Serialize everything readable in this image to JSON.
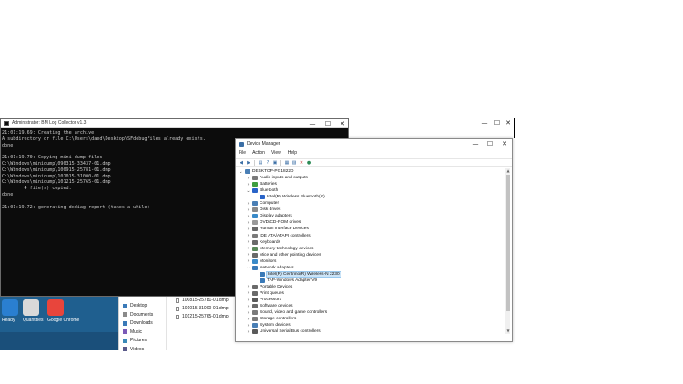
{
  "console": {
    "title": "Administrator: BM Log Collector v1.3",
    "lines": [
      "21:01:19.69: Creating the archive",
      "A subdirectory or file C:\\Users\\daed\\Desktop\\SFdebugFiles already exists.",
      "done",
      "",
      "21:01:19.70: Copying mini dump files",
      "C:\\Windows\\minidump\\090315-33437-01.dmp",
      "C:\\Windows\\minidump\\100915-25781-01.dmp",
      "C:\\Windows\\minidump\\101015-31000-01.dmp",
      "C:\\Windows\\minidump\\101215-25765-01.dmp",
      "        4 file(s) copied.",
      "done",
      "",
      "21:01:19.72: generating dxdiag report (takes a while)"
    ],
    "controls": {
      "minimize": "—",
      "maximize": "☐",
      "close": "✕"
    }
  },
  "bg_window": {
    "controls": {
      "minimize": "—",
      "maximize": "☐",
      "close": "✕"
    }
  },
  "desktop": {
    "icons": [
      {
        "label": "Ready",
        "color": "#2a7fd0"
      },
      {
        "label": "Quantities",
        "color": "#d9d9d9"
      },
      {
        "label": "Google Chrome",
        "color": "#e8453c"
      },
      {
        "label": "",
        "color": "#3b8ad8"
      },
      {
        "label": "",
        "color": "#22a83c"
      },
      {
        "label": "",
        "color": "#f4c542"
      }
    ]
  },
  "explorer": {
    "nav": [
      "Desktop",
      "Documents",
      "Downloads",
      "Music",
      "Pictures",
      "Videos"
    ],
    "files": [
      "100815-25781-01.dmp",
      "101015-31000-01.dmp",
      "101215-25765-01.dmp"
    ]
  },
  "device_manager": {
    "title": "Device Manager",
    "menu": [
      "File",
      "Action",
      "View",
      "Help"
    ],
    "controls": {
      "minimize": "—",
      "maximize": "☐",
      "close": "✕"
    },
    "tree": [
      {
        "label": "DESKTOP-PG1822D",
        "level": 0,
        "expander": "⌄",
        "icon": "computer",
        "color": "#4a7fb5"
      },
      {
        "label": "Audio inputs and outputs",
        "level": 1,
        "expander": "›",
        "icon": "audio",
        "color": "#7a7a7a"
      },
      {
        "label": "Batteries",
        "level": 1,
        "expander": "›",
        "icon": "battery",
        "color": "#3f9e3f"
      },
      {
        "label": "Bluetooth",
        "level": 1,
        "expander": "⌄",
        "icon": "bluetooth",
        "color": "#2a64c8"
      },
      {
        "label": "Intel(R) Wireless Bluetooth(R)",
        "level": 2,
        "expander": "",
        "icon": "bluetooth",
        "color": "#2a64c8"
      },
      {
        "label": "Computer",
        "level": 1,
        "expander": "›",
        "icon": "computer",
        "color": "#4a7fb5"
      },
      {
        "label": "Disk drives",
        "level": 1,
        "expander": "›",
        "icon": "disk",
        "color": "#8a8a8a"
      },
      {
        "label": "Display adapters",
        "level": 1,
        "expander": "›",
        "icon": "display",
        "color": "#3a8ac8"
      },
      {
        "label": "DVD/CD-ROM drives",
        "level": 1,
        "expander": "›",
        "icon": "dvd",
        "color": "#9a9a9a"
      },
      {
        "label": "Human Interface Devices",
        "level": 1,
        "expander": "›",
        "icon": "hid",
        "color": "#6a6a6a"
      },
      {
        "label": "IDE ATA/ATAPI controllers",
        "level": 1,
        "expander": "›",
        "icon": "ide",
        "color": "#7a7a7a"
      },
      {
        "label": "Keyboards",
        "level": 1,
        "expander": "›",
        "icon": "keyboard",
        "color": "#6a6a6a"
      },
      {
        "label": "Memory technology devices",
        "level": 1,
        "expander": "›",
        "icon": "memory",
        "color": "#5a8a5a"
      },
      {
        "label": "Mice and other pointing devices",
        "level": 1,
        "expander": "›",
        "icon": "mouse",
        "color": "#6a6a6a"
      },
      {
        "label": "Monitors",
        "level": 1,
        "expander": "›",
        "icon": "monitor",
        "color": "#3a8ac8"
      },
      {
        "label": "Network adapters",
        "level": 1,
        "expander": "⌄",
        "icon": "network",
        "color": "#3a7ab8"
      },
      {
        "label": "Intel(R) Centrino(R) Wireless-N 2230",
        "level": 2,
        "expander": "",
        "icon": "network",
        "color": "#3a7ab8",
        "selected": true
      },
      {
        "label": "TAP-Windows Adapter V9",
        "level": 2,
        "expander": "",
        "icon": "network",
        "color": "#3a7ab8"
      },
      {
        "label": "Portable Devices",
        "level": 1,
        "expander": "›",
        "icon": "portable",
        "color": "#6a6a6a"
      },
      {
        "label": "Print queues",
        "level": 1,
        "expander": "›",
        "icon": "printer",
        "color": "#6a6a6a"
      },
      {
        "label": "Processors",
        "level": 1,
        "expander": "›",
        "icon": "processor",
        "color": "#5a5a5a"
      },
      {
        "label": "Software devices",
        "level": 1,
        "expander": "›",
        "icon": "software",
        "color": "#6a6a6a"
      },
      {
        "label": "Sound, video and game controllers",
        "level": 1,
        "expander": "›",
        "icon": "sound",
        "color": "#7a7a7a"
      },
      {
        "label": "Storage controllers",
        "level": 1,
        "expander": "›",
        "icon": "storage",
        "color": "#7a7a7a"
      },
      {
        "label": "System devices",
        "level": 1,
        "expander": "›",
        "icon": "system",
        "color": "#4a7fb5"
      },
      {
        "label": "Universal Serial Bus controllers",
        "level": 1,
        "expander": "›",
        "icon": "usb",
        "color": "#5a5a5a"
      }
    ]
  }
}
